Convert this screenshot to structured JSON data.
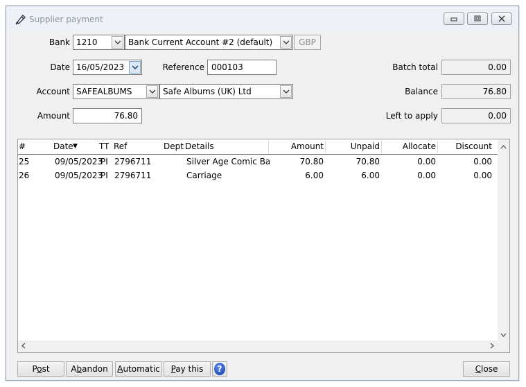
{
  "window": {
    "title": "Supplier payment"
  },
  "form": {
    "bank_label": "Bank",
    "bank_code": "1210",
    "bank_name": "Bank Current Account #2 (default)",
    "currency": "GBP",
    "date_label": "Date",
    "date_value": "16/05/2023",
    "reference_label": "Reference",
    "reference_value": "000103",
    "account_label": "Account",
    "account_code": "SAFEALBUMS",
    "account_name": "Safe Albums (UK) Ltd",
    "amount_label": "Amount",
    "amount_value": "76.80",
    "batch_total_label": "Batch total",
    "batch_total_value": "0.00",
    "balance_label": "Balance",
    "balance_value": "76.80",
    "left_to_apply_label": "Left to apply",
    "left_to_apply_value": "0.00"
  },
  "grid": {
    "columns": {
      "num": "#",
      "date": "Date",
      "tt": "TT",
      "ref": "Ref",
      "dept": "Dept",
      "details": "Details",
      "amount": "Amount",
      "unpaid": "Unpaid",
      "allocate": "Allocate",
      "discount": "Discount"
    },
    "sort_indicator": "▼",
    "rows": [
      {
        "num": "25",
        "date": "09/05/2023",
        "tt": "PI",
        "ref": "2796711",
        "dept": "",
        "details": "Silver Age Comic Bag",
        "amount": "70.80",
        "unpaid": "70.80",
        "allocate": "0.00",
        "discount": "0.00"
      },
      {
        "num": "26",
        "date": "09/05/2023",
        "tt": "PI",
        "ref": "2796711",
        "dept": "",
        "details": "Carriage",
        "amount": "6.00",
        "unpaid": "6.00",
        "allocate": "0.00",
        "discount": "0.00"
      }
    ]
  },
  "buttons": {
    "post_pre": "P",
    "post_u": "o",
    "post_post": "st",
    "abandon_pre": "A",
    "abandon_u": "b",
    "abandon_post": "andon",
    "automatic_pre": "",
    "automatic_u": "A",
    "automatic_post": "utomatic",
    "paythis_pre": "",
    "paythis_u": "P",
    "paythis_post": "ay this",
    "close_pre": "",
    "close_u": "C",
    "close_post": "lose",
    "help_glyph": "?"
  },
  "icons": {
    "window": "supplier-payment-icon",
    "minimize": "minimize-icon",
    "maximize": "maximize-icon",
    "close": "close-icon",
    "dropdown": "chevron-down-icon",
    "help": "help-icon"
  }
}
